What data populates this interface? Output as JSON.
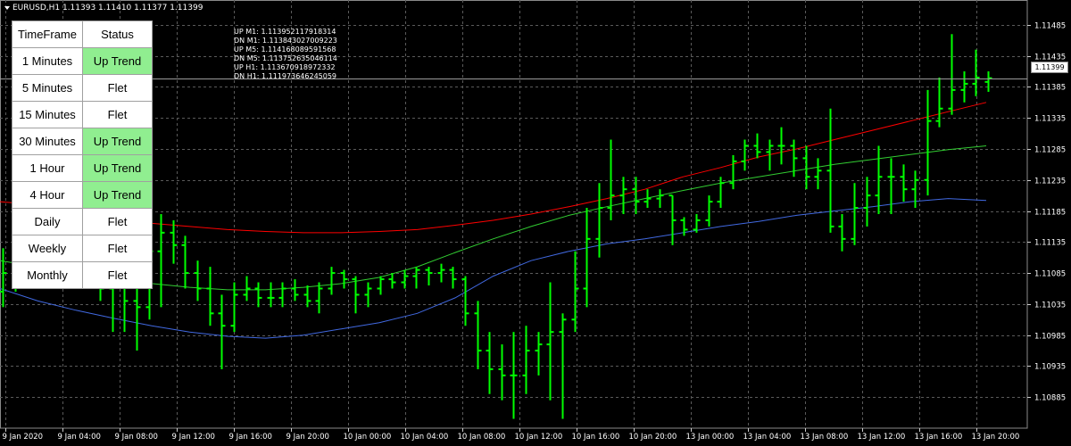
{
  "symbol_title": "EURUSD,H1  1.11393 1.11410 1.11377 1.11399",
  "current_price_label": "1.11399",
  "table": {
    "headers": [
      "TimeFrame",
      "Status"
    ],
    "rows": [
      {
        "timeframe": "1 Minutes",
        "status": "Up Trend",
        "up": true
      },
      {
        "timeframe": "5 Minutes",
        "status": "Flet",
        "up": false
      },
      {
        "timeframe": "15 Minutes",
        "status": "Flet",
        "up": false
      },
      {
        "timeframe": "30 Minutes",
        "status": "Up Trend",
        "up": true
      },
      {
        "timeframe": "1 Hour",
        "status": "Up Trend",
        "up": true
      },
      {
        "timeframe": "4 Hour",
        "status": "Up Trend",
        "up": true
      },
      {
        "timeframe": "Daily",
        "status": "Flet",
        "up": false
      },
      {
        "timeframe": "Weekly",
        "status": "Flet",
        "up": false
      },
      {
        "timeframe": "Monthly",
        "status": "Flet",
        "up": false
      }
    ]
  },
  "levels": [
    "UP M1: 1.113952117918314",
    "DN M1: 1.113843027009223",
    "UP M5: 1.114168089591568",
    "DN M5: 1.113752635046114",
    "UP H1: 1.113670918972332",
    "DN H1: 1.111973646245059"
  ],
  "colors": {
    "background": "#000000",
    "grid": "#5a5a5a",
    "bars": "#00ff00",
    "upper_band": "#ff0000",
    "middle_band": "#32cd32",
    "lower_band": "#4169e1",
    "up_trend_cell": "#90ee90"
  },
  "chart_data": {
    "type": "ohlc",
    "symbol": "EURUSD",
    "timeframe": "H1",
    "ylim": [
      1.10835,
      1.11525
    ],
    "y_ticks": [
      "1.11485",
      "1.11435",
      "1.11385",
      "1.11335",
      "1.11285",
      "1.11235",
      "1.11185",
      "1.11135",
      "1.11085",
      "1.11035",
      "1.10985",
      "1.10935",
      "1.10885"
    ],
    "x_ticks": [
      "9 Jan 2020",
      "9 Jan 04:00",
      "9 Jan 08:00",
      "9 Jan 12:00",
      "9 Jan 16:00",
      "9 Jan 20:00",
      "10 Jan 00:00",
      "10 Jan 04:00",
      "10 Jan 08:00",
      "10 Jan 12:00",
      "10 Jan 16:00",
      "10 Jan 20:00",
      "13 Jan 00:00",
      "13 Jan 04:00",
      "13 Jan 08:00",
      "13 Jan 12:00",
      "13 Jan 16:00",
      "13 Jan 20:00"
    ],
    "bars": [
      {
        "o": 1.11055,
        "h": 1.11125,
        "l": 1.1103,
        "c": 1.11085
      },
      {
        "o": 1.11085,
        "h": 1.11175,
        "l": 1.11055,
        "c": 1.1115
      },
      {
        "o": 1.1115,
        "h": 1.1118,
        "l": 1.1112,
        "c": 1.11155
      },
      {
        "o": 1.11155,
        "h": 1.11175,
        "l": 1.11125,
        "c": 1.11145
      },
      {
        "o": 1.11145,
        "h": 1.1116,
        "l": 1.1113,
        "c": 1.11148
      },
      {
        "o": 1.11148,
        "h": 1.1117,
        "l": 1.111,
        "c": 1.1114
      },
      {
        "o": 1.1114,
        "h": 1.112,
        "l": 1.1113,
        "c": 1.1115
      },
      {
        "o": 1.1115,
        "h": 1.11195,
        "l": 1.1112,
        "c": 1.1113
      },
      {
        "o": 1.1113,
        "h": 1.112,
        "l": 1.1104,
        "c": 1.1106
      },
      {
        "o": 1.1106,
        "h": 1.1118,
        "l": 1.1099,
        "c": 1.1112
      },
      {
        "o": 1.1112,
        "h": 1.1119,
        "l": 1.1099,
        "c": 1.1104
      },
      {
        "o": 1.1104,
        "h": 1.1116,
        "l": 1.1096,
        "c": 1.1103
      },
      {
        "o": 1.1103,
        "h": 1.1114,
        "l": 1.1101,
        "c": 1.1112
      },
      {
        "o": 1.1112,
        "h": 1.1118,
        "l": 1.1103,
        "c": 1.1115
      },
      {
        "o": 1.1115,
        "h": 1.1117,
        "l": 1.111,
        "c": 1.1113
      },
      {
        "o": 1.1113,
        "h": 1.11145,
        "l": 1.1106,
        "c": 1.11085
      },
      {
        "o": 1.11085,
        "h": 1.11105,
        "l": 1.1104,
        "c": 1.1106
      },
      {
        "o": 1.1106,
        "h": 1.11095,
        "l": 1.11,
        "c": 1.1102
      },
      {
        "o": 1.1102,
        "h": 1.1105,
        "l": 1.1093,
        "c": 1.11
      },
      {
        "o": 1.11,
        "h": 1.1107,
        "l": 1.1099,
        "c": 1.1105
      },
      {
        "o": 1.1105,
        "h": 1.1108,
        "l": 1.1104,
        "c": 1.1106
      },
      {
        "o": 1.1106,
        "h": 1.1107,
        "l": 1.1103,
        "c": 1.11045
      },
      {
        "o": 1.11045,
        "h": 1.1107,
        "l": 1.1103,
        "c": 1.11045
      },
      {
        "o": 1.11045,
        "h": 1.1107,
        "l": 1.1103,
        "c": 1.1106
      },
      {
        "o": 1.1106,
        "h": 1.11075,
        "l": 1.1104,
        "c": 1.1105
      },
      {
        "o": 1.1105,
        "h": 1.11065,
        "l": 1.1103,
        "c": 1.1104
      },
      {
        "o": 1.1104,
        "h": 1.1107,
        "l": 1.1102,
        "c": 1.1106
      },
      {
        "o": 1.1106,
        "h": 1.11095,
        "l": 1.1105,
        "c": 1.11085
      },
      {
        "o": 1.11085,
        "h": 1.1109,
        "l": 1.1106,
        "c": 1.11075
      },
      {
        "o": 1.11075,
        "h": 1.1108,
        "l": 1.1102,
        "c": 1.1105
      },
      {
        "o": 1.1105,
        "h": 1.1107,
        "l": 1.1103,
        "c": 1.1106
      },
      {
        "o": 1.1106,
        "h": 1.1108,
        "l": 1.1105,
        "c": 1.11075
      },
      {
        "o": 1.11075,
        "h": 1.11085,
        "l": 1.1106,
        "c": 1.1107
      },
      {
        "o": 1.1107,
        "h": 1.1109,
        "l": 1.1106,
        "c": 1.1108
      },
      {
        "o": 1.1108,
        "h": 1.11095,
        "l": 1.1106,
        "c": 1.1109
      },
      {
        "o": 1.1109,
        "h": 1.11095,
        "l": 1.11065,
        "c": 1.11085
      },
      {
        "o": 1.11085,
        "h": 1.111,
        "l": 1.1107,
        "c": 1.1109
      },
      {
        "o": 1.1109,
        "h": 1.11095,
        "l": 1.1106,
        "c": 1.11075
      },
      {
        "o": 1.11075,
        "h": 1.1108,
        "l": 1.11,
        "c": 1.1102
      },
      {
        "o": 1.1102,
        "h": 1.1104,
        "l": 1.1093,
        "c": 1.1096
      },
      {
        "o": 1.1096,
        "h": 1.1099,
        "l": 1.1089,
        "c": 1.1093
      },
      {
        "o": 1.1093,
        "h": 1.1097,
        "l": 1.1088,
        "c": 1.1092
      },
      {
        "o": 1.1092,
        "h": 1.1099,
        "l": 1.1085,
        "c": 1.1092
      },
      {
        "o": 1.1092,
        "h": 1.11,
        "l": 1.1089,
        "c": 1.1096
      },
      {
        "o": 1.1096,
        "h": 1.1099,
        "l": 1.1092,
        "c": 1.1097
      },
      {
        "o": 1.1097,
        "h": 1.1107,
        "l": 1.1088,
        "c": 1.1099
      },
      {
        "o": 1.1099,
        "h": 1.1102,
        "l": 1.1085,
        "c": 1.1101
      },
      {
        "o": 1.1101,
        "h": 1.1112,
        "l": 1.1099,
        "c": 1.1106
      },
      {
        "o": 1.1106,
        "h": 1.1119,
        "l": 1.1103,
        "c": 1.1114
      },
      {
        "o": 1.1114,
        "h": 1.1123,
        "l": 1.1111,
        "c": 1.1119
      },
      {
        "o": 1.1119,
        "h": 1.113,
        "l": 1.1117,
        "c": 1.1121
      },
      {
        "o": 1.1121,
        "h": 1.1124,
        "l": 1.1118,
        "c": 1.1122
      },
      {
        "o": 1.1122,
        "h": 1.1124,
        "l": 1.1118,
        "c": 1.112
      },
      {
        "o": 1.112,
        "h": 1.1122,
        "l": 1.1119,
        "c": 1.11205
      },
      {
        "o": 1.11205,
        "h": 1.1122,
        "l": 1.1119,
        "c": 1.1121
      },
      {
        "o": 1.1121,
        "h": 1.1121,
        "l": 1.1113,
        "c": 1.1117
      },
      {
        "o": 1.1117,
        "h": 1.11175,
        "l": 1.11145,
        "c": 1.11155
      },
      {
        "o": 1.11155,
        "h": 1.1118,
        "l": 1.1115,
        "c": 1.1117
      },
      {
        "o": 1.1117,
        "h": 1.1121,
        "l": 1.1116,
        "c": 1.112
      },
      {
        "o": 1.112,
        "h": 1.1124,
        "l": 1.1119,
        "c": 1.1123
      },
      {
        "o": 1.1123,
        "h": 1.11275,
        "l": 1.1122,
        "c": 1.11265
      },
      {
        "o": 1.11265,
        "h": 1.113,
        "l": 1.1125,
        "c": 1.1129
      },
      {
        "o": 1.1129,
        "h": 1.1131,
        "l": 1.1127,
        "c": 1.1128
      },
      {
        "o": 1.1128,
        "h": 1.113,
        "l": 1.1125,
        "c": 1.1129
      },
      {
        "o": 1.1129,
        "h": 1.1132,
        "l": 1.1126,
        "c": 1.1129
      },
      {
        "o": 1.1129,
        "h": 1.113,
        "l": 1.1124,
        "c": 1.1127
      },
      {
        "o": 1.1127,
        "h": 1.1129,
        "l": 1.1122,
        "c": 1.1124
      },
      {
        "o": 1.1124,
        "h": 1.1127,
        "l": 1.1122,
        "c": 1.1125
      },
      {
        "o": 1.1125,
        "h": 1.1135,
        "l": 1.1115,
        "c": 1.1116
      },
      {
        "o": 1.1116,
        "h": 1.1118,
        "l": 1.1112,
        "c": 1.1114
      },
      {
        "o": 1.1114,
        "h": 1.1123,
        "l": 1.1113,
        "c": 1.1119
      },
      {
        "o": 1.1119,
        "h": 1.1124,
        "l": 1.1116,
        "c": 1.1121
      },
      {
        "o": 1.1121,
        "h": 1.1129,
        "l": 1.1118,
        "c": 1.1124
      },
      {
        "o": 1.1124,
        "h": 1.1127,
        "l": 1.1118,
        "c": 1.1124
      },
      {
        "o": 1.1124,
        "h": 1.1126,
        "l": 1.112,
        "c": 1.1122
      },
      {
        "o": 1.1122,
        "h": 1.1125,
        "l": 1.1119,
        "c": 1.11235
      },
      {
        "o": 1.11235,
        "h": 1.1138,
        "l": 1.1121,
        "c": 1.1133
      },
      {
        "o": 1.1133,
        "h": 1.114,
        "l": 1.1132,
        "c": 1.1135
      },
      {
        "o": 1.1135,
        "h": 1.1147,
        "l": 1.1134,
        "c": 1.1138
      },
      {
        "o": 1.1138,
        "h": 1.1141,
        "l": 1.1136,
        "c": 1.1139
      },
      {
        "o": 1.1139,
        "h": 1.11445,
        "l": 1.1137,
        "c": 1.114
      },
      {
        "o": 1.11393,
        "h": 1.1141,
        "l": 1.11377,
        "c": 1.11399
      }
    ],
    "upper_band": [
      1.112,
      1.11195,
      1.11185,
      1.11175,
      1.11165,
      1.1116,
      1.11155,
      1.11152,
      1.1115,
      1.1115,
      1.11152,
      1.11155,
      1.11162,
      1.1117,
      1.1118,
      1.11192,
      1.11205,
      1.1122,
      1.1124,
      1.11255,
      1.11272,
      1.11285,
      1.113,
      1.11315,
      1.1133,
      1.11345,
      1.1136
    ],
    "middle_band": [
      1.11105,
      1.11095,
      1.11085,
      1.11075,
      1.11068,
      1.11062,
      1.11058,
      1.11058,
      1.11062,
      1.11068,
      1.11078,
      1.11095,
      1.11118,
      1.1114,
      1.1116,
      1.11178,
      1.11192,
      1.11205,
      1.11218,
      1.1123,
      1.1124,
      1.1125,
      1.1126,
      1.11268,
      1.11276,
      1.11284,
      1.1129
    ],
    "lower_band": [
      1.1106,
      1.1104,
      1.11025,
      1.11012,
      1.11,
      1.1099,
      1.10983,
      1.1098,
      1.10985,
      1.10995,
      1.11005,
      1.1102,
      1.11045,
      1.1108,
      1.11105,
      1.1112,
      1.11132,
      1.1114,
      1.1115,
      1.1116,
      1.11168,
      1.11178,
      1.11185,
      1.11192,
      1.112,
      1.11205,
      1.11202
    ]
  }
}
